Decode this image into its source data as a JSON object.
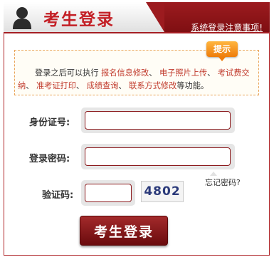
{
  "header": {
    "title": "考生登录",
    "notice_link": "系统登录注意事项!"
  },
  "notice": {
    "badge": "提示",
    "lead": "登录之后可以执行",
    "links": [
      "报名信息修改",
      "电子照片上传",
      "考试费交纳",
      "准考证打印",
      "成绩查询",
      "联系方式修改"
    ],
    "tail": "等功能。"
  },
  "form": {
    "id_label": "身份证号:",
    "id_value": "",
    "password_label": "登录密码:",
    "password_value": "",
    "captcha_label": "验证码:",
    "captcha_value": "",
    "captcha_image_text": "4802",
    "forgot_label": "忘记密码?"
  },
  "login_button": "考生登录",
  "colors": {
    "brand_red": "#a51f24",
    "link_red": "#c0392b",
    "badge_orange": "#ee7c0a"
  }
}
